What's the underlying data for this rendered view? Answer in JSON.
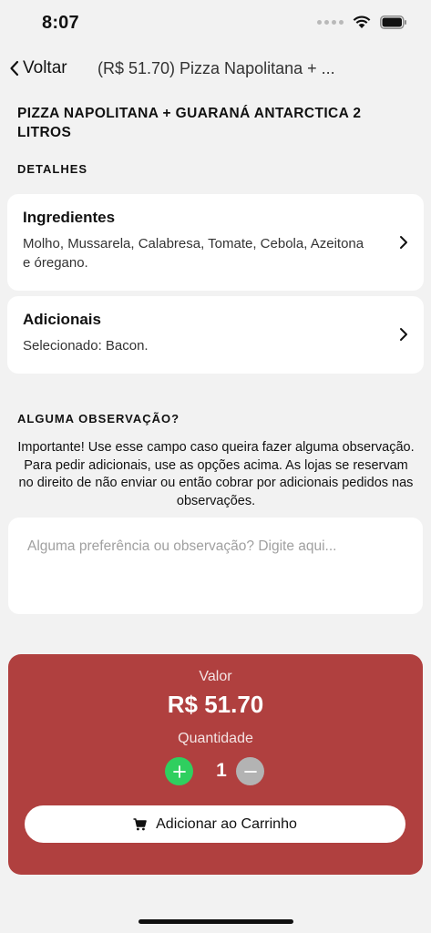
{
  "status_bar": {
    "time": "8:07"
  },
  "nav": {
    "back_label": "Voltar",
    "title": "(R$ 51.70) Pizza Napolitana + ..."
  },
  "product": {
    "title": "PIZZA NAPOLITANA + GUARANÁ ANTARCTICA 2 LITROS"
  },
  "details": {
    "section_label": "DETALHES",
    "ingredients": {
      "title": "Ingredientes",
      "text": "Molho, Mussarela, Calabresa, Tomate, Cebola, Azeitona e óregano."
    },
    "extras": {
      "title": "Adicionais",
      "text": "Selecionado: Bacon."
    }
  },
  "notes": {
    "section_label": "ALGUMA OBSERVAÇÃO?",
    "info": "Importante! Use esse campo caso queira fazer alguma observação. Para pedir adicionais, use as opções acima. As lojas se reservam no direito de não enviar ou então cobrar por adicionais pedidos nas observações.",
    "placeholder": "Alguma preferência ou observação? Digite aqui...",
    "value": ""
  },
  "summary": {
    "value_label": "Valor",
    "value": "R$ 51.70",
    "quantity_label": "Quantidade",
    "quantity": "1",
    "cart_button_label": "Adicionar ao Carrinho"
  },
  "colors": {
    "summary_bg": "#b0403f",
    "plus_button": "#2fcf5f",
    "minus_button": "#b3b3b3"
  }
}
